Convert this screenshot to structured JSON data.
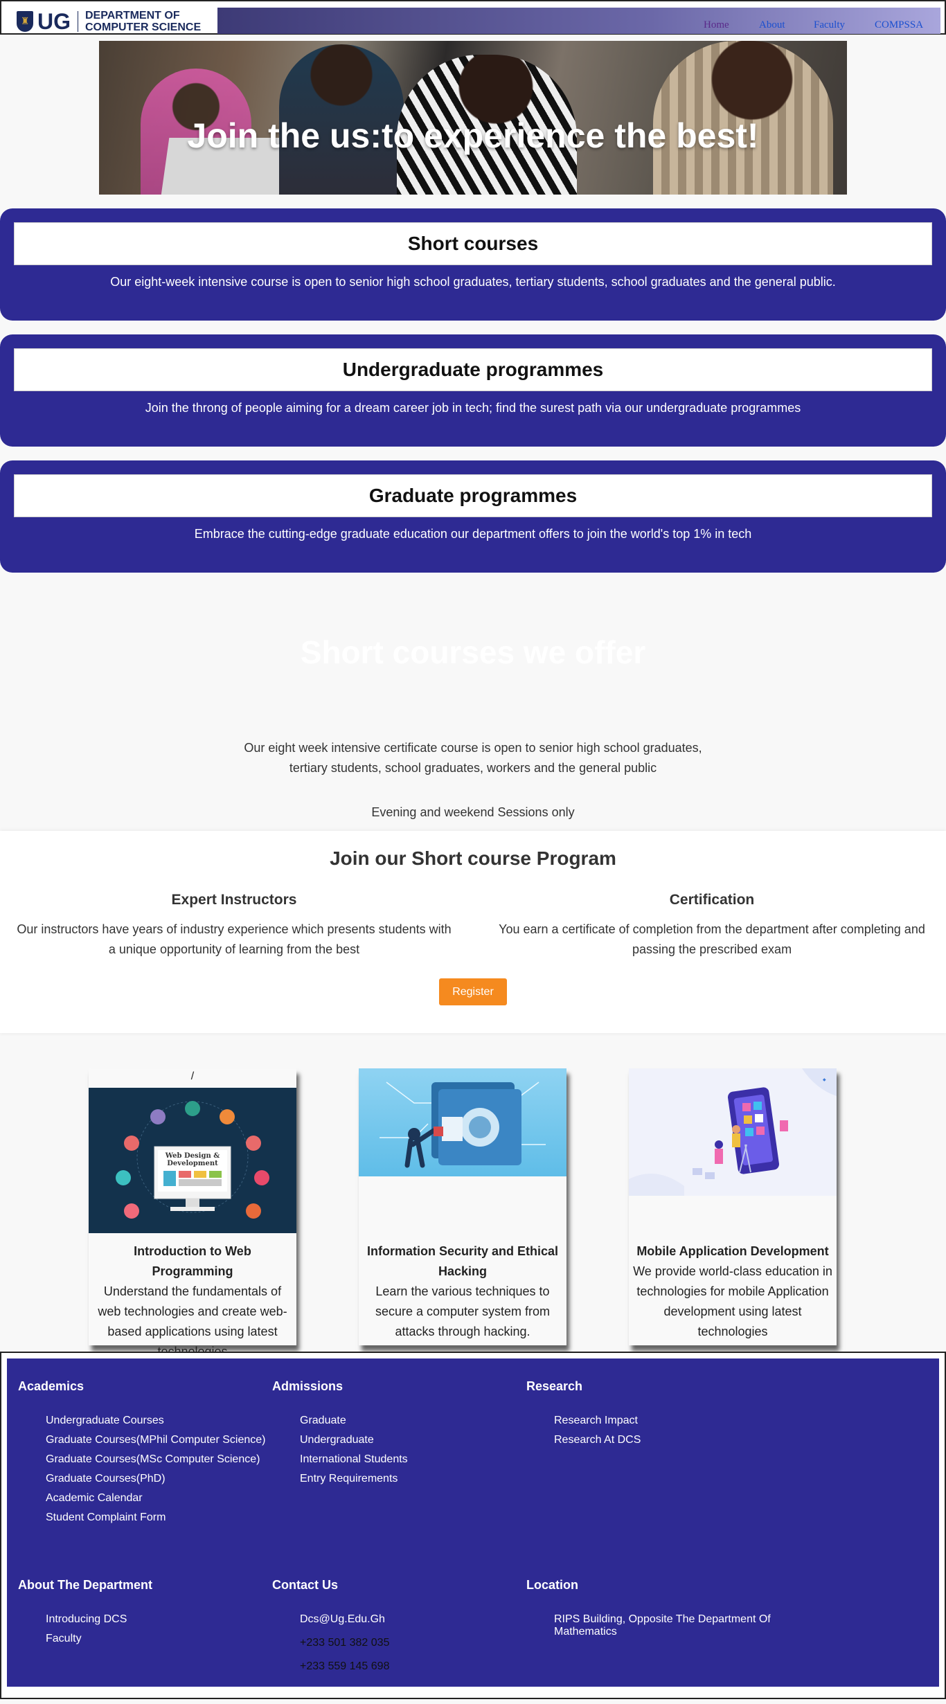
{
  "header": {
    "logo_text": "UG",
    "department_line1": "DEPARTMENT OF",
    "department_line2": "COMPUTER SCIENCE",
    "nav": [
      "Home",
      "About",
      "Faculty",
      "COMPSSA"
    ]
  },
  "hero": {
    "title": "Join the us:to experience the best!"
  },
  "programs": [
    {
      "title": "Short courses",
      "text": "Our eight-week intensive course is open to senior high school graduates, tertiary students, school graduates and the general public."
    },
    {
      "title": "Undergraduate programmes",
      "text": "Join the throng of people aiming for a dream career job in tech; find the surest path via our undergraduate programmes"
    },
    {
      "title": "Graduate programmes",
      "text": "Embrace the cutting-edge graduate education our department offers to join the world's top 1% in tech"
    }
  ],
  "offer": {
    "title": "Short courses we offer",
    "text": "Our eight week intensive certificate course is open to senior high school graduates, tertiary students, school graduates, workers and the general public",
    "sessions": "Evening and weekend Sessions only"
  },
  "join": {
    "title": "Join our Short course Program",
    "features": [
      {
        "title": "Expert Instructors",
        "text": "Our instructors have years of industry experience which presents students with a unique opportunity of learning from the best"
      },
      {
        "title": "Certification",
        "text": "You earn a certificate of completion from the department after completing and passing the prescribed exam"
      }
    ],
    "register_label": "Register"
  },
  "courses": [
    {
      "slash": "/",
      "image_text": "Web Design & Development",
      "title": "Introduction to Web Programming",
      "description": "Understand the fundamentals of web technologies and create web-based applications using latest technologies"
    },
    {
      "title": "Information Security and Ethical Hacking",
      "description": "Learn the various techniques to secure a computer system from attacks through hacking."
    },
    {
      "title": "Mobile Application Development",
      "description": "We provide world-class education in technologies for mobile Application development using latest technologies"
    }
  ],
  "footer": {
    "academics": {
      "title": "Academics",
      "items": [
        "Undergraduate Courses",
        "Graduate Courses(MPhil Computer Science)",
        "Graduate Courses(MSc Computer Science)",
        "Graduate Courses(PhD)",
        "Academic Calendar",
        "Student Complaint Form"
      ]
    },
    "admissions": {
      "title": "Admissions",
      "items": [
        "Graduate",
        "Undergraduate",
        "International Students",
        "Entry Requirements"
      ]
    },
    "research": {
      "title": "Research",
      "items": [
        "Research Impact",
        "Research At DCS"
      ]
    },
    "about": {
      "title": "About The Department",
      "items": [
        "Introducing DCS",
        "Faculty"
      ]
    },
    "contact": {
      "title": "Contact Us",
      "email": "Dcs@Ug.Edu.Gh",
      "phones": [
        "+233 501 382 035",
        "+233 559 145 698"
      ]
    },
    "location": {
      "title": "Location",
      "address": "RIPS Building, Opposite The Department Of Mathematics"
    }
  },
  "colors": {
    "brand_blue": "#2e2a93",
    "accent_orange": "#f58a1f",
    "navy": "#1a2a5c"
  }
}
